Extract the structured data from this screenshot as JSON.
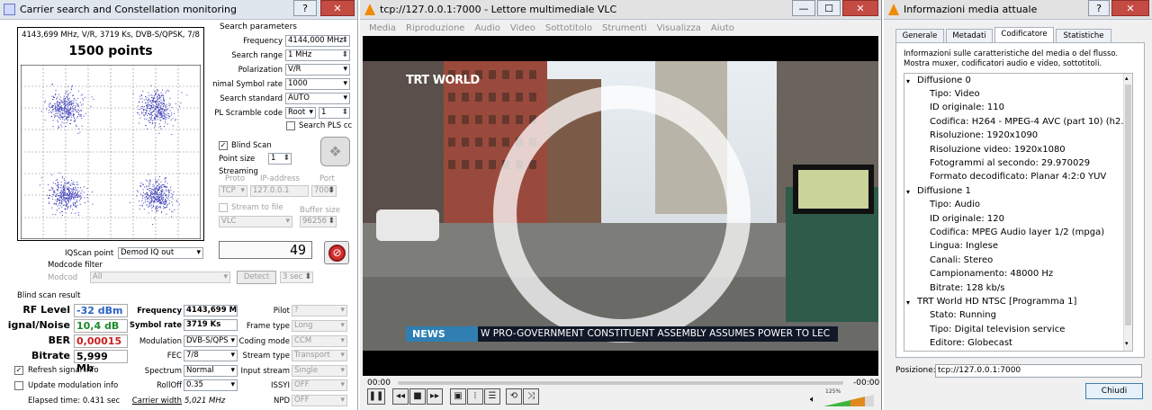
{
  "carrier": {
    "title": "Carrier search and Constellation monitoring",
    "help": "?",
    "close": "✕",
    "info": "4143,699 MHz, V/R, 3719 Ks, DVB-S/QPSK, 7/8",
    "points": "1500 points",
    "search_header": "Search parameters",
    "frequency_label": "Frequency",
    "frequency": "4144,000 MHz",
    "range_label": "Search range",
    "range": "1 MHz",
    "polarization_label": "Polarization",
    "polarization": "V/R",
    "symbol_label": "nimal Symbol rate",
    "symbol": "1000",
    "standard_label": "Search standard",
    "standard": "AUTO",
    "pl_label": "PL Scramble code",
    "pl": "Root",
    "pl_num": "1",
    "search_pls": "Search PLS cc",
    "blind_scan": "Blind Scan",
    "point_size_label": "Point size",
    "point_size": "1",
    "streaming": "Streaming",
    "proto_label": "Proto",
    "proto": "TCP",
    "ip_label": "IP-address",
    "ip": "127.0.0.1",
    "port_label": "Port",
    "port": "7000",
    "stream_file": "Stream to file",
    "buffer_label": "Buffer size",
    "vlc": "VLC",
    "buffer": "96256",
    "counter": "49",
    "iqscan_label": "IQScan point",
    "iqscan": "Demod IQ out",
    "modcode_filter": "Modcode filter",
    "modcode_label": "Modcod",
    "modcode": "All",
    "detect": "Detect",
    "sec": "3 sec",
    "result_header": "Blind scan result",
    "rf_label": "RF Level",
    "rf": "-32 dBm",
    "sn_label": "ignal/Noise",
    "sn": "10,4 dB",
    "ber_label": "BER",
    "ber": "0,00015",
    "bitrate_label": "Bitrate",
    "bitrate": "5,999 Mb",
    "res_freq_label": "Frequency",
    "res_freq": "4143,699 M",
    "res_sym_label": "Symbol rate",
    "res_sym": "3719 Ks",
    "modulation_label": "Modulation",
    "modulation": "DVB-S/QPS",
    "fec_label": "FEC",
    "fec": "7/8",
    "spectrum_label": "Spectrum",
    "spectrum": "Normal",
    "rolloff_label": "RollOff",
    "rolloff": "0.35",
    "carrier_width_label": "Carrier width",
    "carrier_width": "5,021 MHz",
    "pilot_label": "Pilot",
    "pilot": "?",
    "frame_label": "Frame type",
    "frame": "Long",
    "coding_label": "Coding mode",
    "coding": "CCM",
    "stream_type_label": "Stream type",
    "stream_type": "Transport",
    "input_stream_label": "Input stream",
    "input_stream": "Single",
    "issyi_label": "ISSYI",
    "issyi": "OFF",
    "npd_label": "NPD",
    "npd": "OFF",
    "refresh": "Refresh signal info",
    "update_mod": "Update modulation info",
    "elapsed": "Elapsed time: 0.431 sec"
  },
  "vlc": {
    "title": "tcp://127.0.0.1:7000 - Lettore multimediale VLC",
    "menu": [
      "Media",
      "Riproduzione",
      "Audio",
      "Video",
      "Sottotitolo",
      "Strumenti",
      "Visualizza",
      "Aiuto"
    ],
    "logo": "TRT WORLD",
    "news": "NEWS",
    "ticker": "W PRO-GOVERNMENT CONSTITUENT ASSEMBLY ASSUMES POWER TO LEC",
    "time_left": "00:00",
    "time_right": "-00:00",
    "volume": "125%"
  },
  "info": {
    "title": "Informazioni media attuale",
    "tabs": [
      "Generale",
      "Metadati",
      "Codificatore",
      "Statistiche"
    ],
    "desc1": "Informazioni sulle caratteristiche del media o del flusso.",
    "desc2": "Mostra muxer, codificatori audio e video, sottotitoli.",
    "tree": [
      "Diffusione 0",
      "Tipo: Video",
      "ID originale: 110",
      "Codifica: H264 - MPEG-4 AVC (part 10) (h2...",
      "Risoluzione: 1920x1090",
      "Risoluzione video: 1920x1080",
      "Fotogrammi al secondo: 29.970029",
      "Formato decodificato: Planar 4:2:0 YUV",
      "Diffusione 1",
      "Tipo: Audio",
      "ID originale: 120",
      "Codifica: MPEG Audio layer 1/2 (mpga)",
      "Lingua: Inglese",
      "Canali: Stereo",
      "Campionamento: 48000 Hz",
      "Bitrate: 128 kb/s",
      "TRT World HD NTSC [Programma 1]",
      "Stato: Running",
      "Tipo: Digital television service",
      "Editore: Globecast"
    ],
    "position_label": "Posizione:",
    "position": "tcp://127.0.0.1:7000",
    "close": "Chiudi"
  }
}
